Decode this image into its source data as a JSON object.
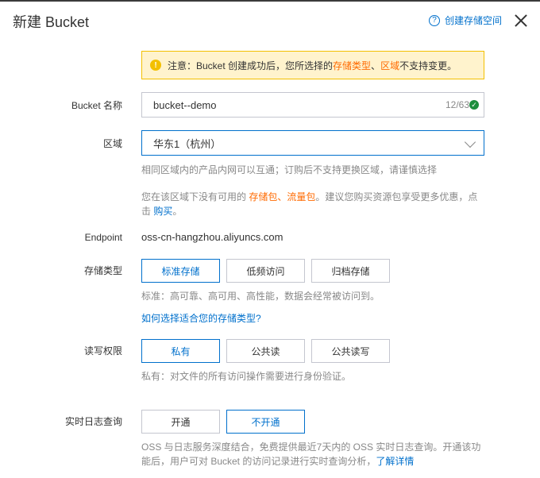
{
  "header": {
    "title": "新建 Bucket",
    "help_link": "创建存储空间"
  },
  "notice": {
    "prefix": "注意：Bucket 创建成功后，您所选择的",
    "storage_type": "存储类型",
    "sep": "、",
    "region": "区域",
    "suffix": "不支持变更。"
  },
  "bucket_name": {
    "label": "Bucket 名称",
    "value": "bucket--demo",
    "counter": "12/63"
  },
  "region": {
    "label": "区域",
    "value": "华东1（杭州）",
    "hint": "相同区域内的产品内网可以互通；订购后不支持更换区域，请谨慎选择"
  },
  "package_hint": {
    "prefix": "您在该区域下没有可用的 ",
    "storage_pkg": "存储包",
    "sep": "、",
    "traffic_pkg": "流量包",
    "middle": "。建议您购买资源包享受更多优惠，点击 ",
    "buy": "购买",
    "suffix": "。"
  },
  "endpoint": {
    "label": "Endpoint",
    "value": "oss-cn-hangzhou.aliyuncs.com"
  },
  "storage_type": {
    "label": "存储类型",
    "options": [
      "标准存储",
      "低频访问",
      "归档存储"
    ],
    "selected": "标准存储",
    "hint": "标准：高可靠、高可用、高性能，数据会经常被访问到。",
    "help_link": "如何选择适合您的存储类型?"
  },
  "acl": {
    "label": "读写权限",
    "options": [
      "私有",
      "公共读",
      "公共读写"
    ],
    "selected": "私有",
    "hint": "私有：对文件的所有访问操作需要进行身份验证。"
  },
  "realtime_log": {
    "label": "实时日志查询",
    "options": [
      "开通",
      "不开通"
    ],
    "selected": "不开通",
    "hint": "OSS 与日志服务深度结合，免费提供最近7天内的 OSS 实时日志查询。开通该功能后，用户可对 Bucket 的访问记录进行实时查询分析，",
    "learn_more": "了解详情"
  }
}
